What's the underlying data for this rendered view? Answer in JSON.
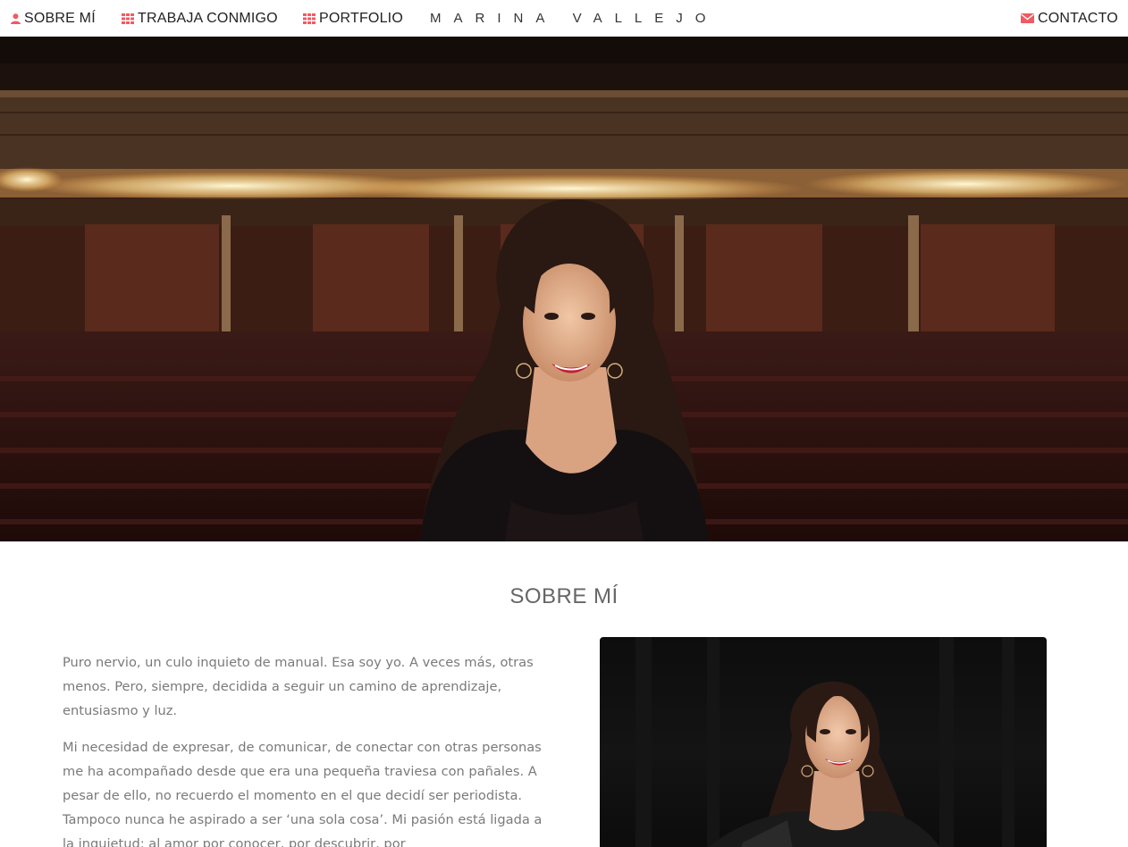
{
  "nav": {
    "items": [
      {
        "label": "SOBRE MÍ",
        "icon": "user-icon"
      },
      {
        "label": "TRABAJA CONMIGO",
        "icon": "grid-icon"
      },
      {
        "label": "PORTFOLIO",
        "icon": "grid-icon"
      }
    ],
    "brand": "MARINA VALLEJO",
    "contact": {
      "label": "CONTACTO",
      "icon": "envelope-icon"
    }
  },
  "hero": {
    "image": "woman-in-theater-photo"
  },
  "about": {
    "title": "SOBRE MÍ",
    "paragraphs": [
      "Puro nervio, un culo inquieto de manual. Esa soy yo. A veces más, otras menos. Pero, siempre, decidida a seguir un camino de aprendizaje, entusiasmo y luz.",
      "Mi necesidad de expresar, de comunicar, de conectar con otras personas me ha acompañado desde que era una pequeña traviesa con pañales. A pesar de ello, no recuerdo el momento en el que decidí ser periodista. Tampoco nunca he aspirado a ser ‘una sola cosa’. Mi pasión está ligada a la inquietud: al amor por conocer, por descubrir, por"
    ],
    "photo": "portrait-photo"
  },
  "colors": {
    "accent": "#f05a63",
    "text": "#7a7a7a",
    "heading": "#666666"
  }
}
